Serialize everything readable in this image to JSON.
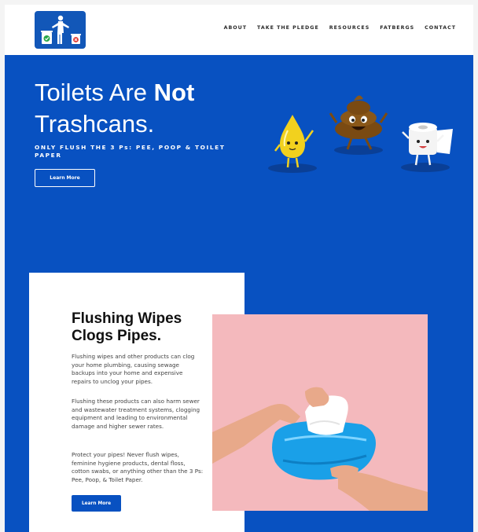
{
  "nav": {
    "items": [
      "ABOUT",
      "TAKE THE PLEDGE",
      "RESOURCES",
      "FATBERGS",
      "CONTACT"
    ]
  },
  "hero": {
    "title_line1_a": "Toilets Are ",
    "title_line1_b": "Not",
    "title_line2": "Trashcans.",
    "subtitle": "ONLY FLUSH THE 3 Ps: PEE, POOP & TOILET PAPER",
    "button_label": "Learn More"
  },
  "card": {
    "heading_line1": "Flushing Wipes",
    "heading_line2": "Clogs Pipes.",
    "paragraph1": "Flushing wipes and other products can clog your home plumbing, causing sewage backups into your home and expensive repairs to unclog your pipes.",
    "paragraph2": "Flushing these products can also harm sewer and wastewater treatment systems, clogging equipment and leading to environmental damage and higher sewer rates.",
    "paragraph3": "Protect your pipes! Never flush wipes, feminine hygiene products, dental floss, cotton swabs, or anything other than the 3 Ps: Pee, Poop, & Toilet Paper.",
    "button_label": "Learn More"
  },
  "colors": {
    "brand_blue": "#0851c1",
    "photo_pink": "#f4b9bd",
    "wipes_pack": "#1aa0e8"
  },
  "icons": [
    "logo-trash-person-icon",
    "pee-drop-character",
    "poop-character",
    "toilet-paper-character",
    "wipes-photo"
  ]
}
